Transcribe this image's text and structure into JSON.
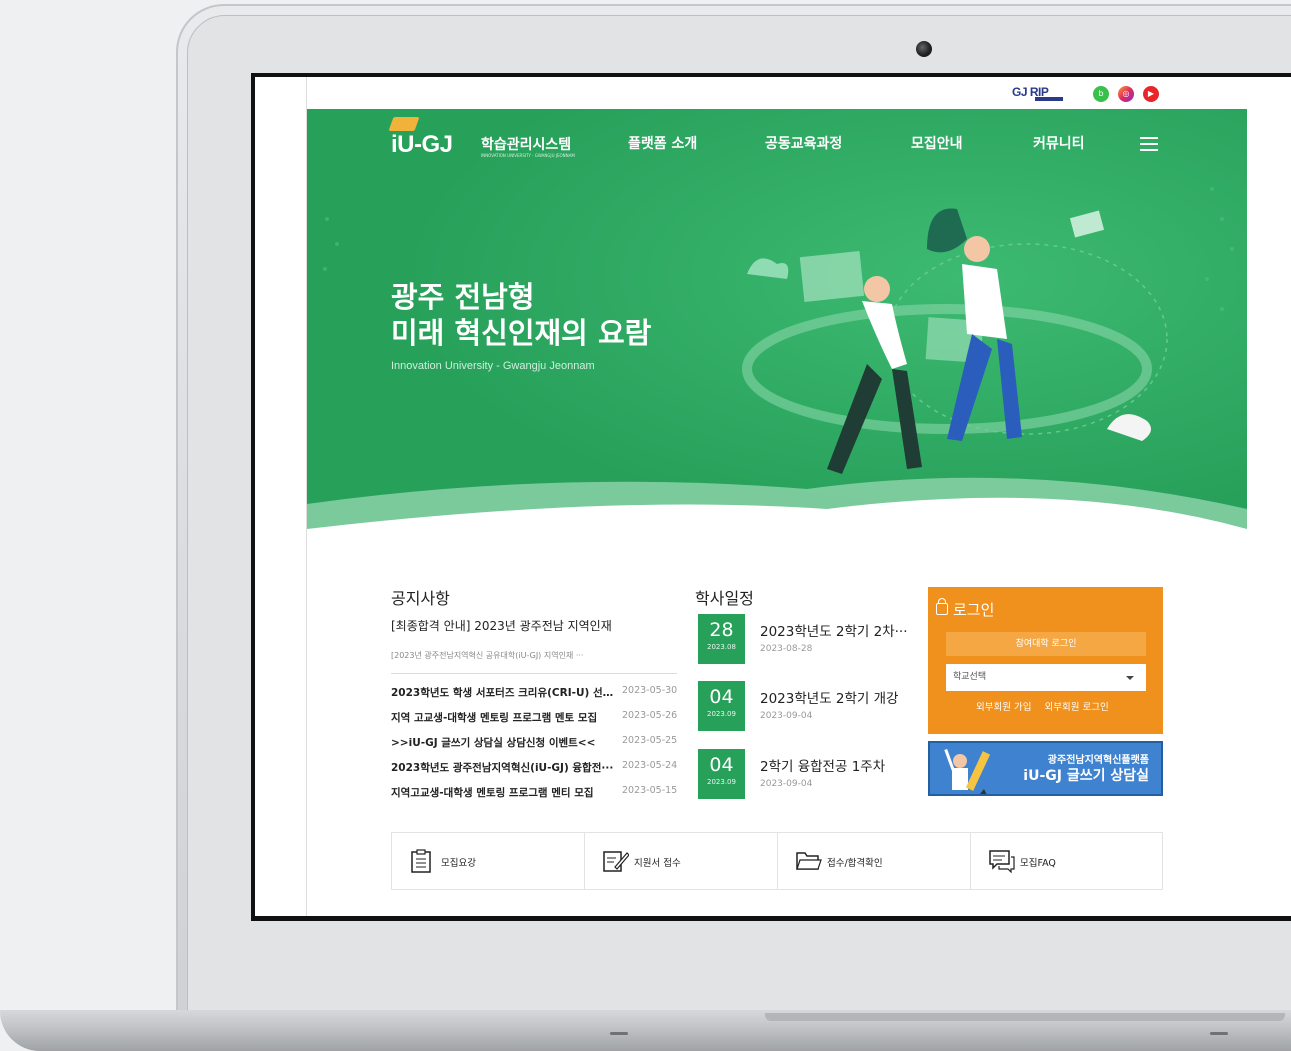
{
  "header": {
    "partner_logo": "GJ RIP",
    "social": [
      "blog-icon",
      "instagram-icon",
      "youtube-icon"
    ]
  },
  "brand": {
    "logo": "iU-GJ",
    "system_name": "학습관리시스템",
    "tagline": "INNOVATION UNIVERSITY · GWANGJU JEONNAM"
  },
  "nav": {
    "items": [
      "플랫폼 소개",
      "공동교육과정",
      "모집안내",
      "커뮤니티"
    ]
  },
  "hero": {
    "title_line1": "광주 전남형",
    "title_line2": "미래 혁신인재의 요람",
    "subtitle": "Innovation University - Gwangju Jeonnam"
  },
  "notices": {
    "title": "공지사항",
    "featured_title": "[최종합격 안내] 2023년 광주전남 지역인재",
    "featured_excerpt": "[2023년 광주전남지역혁신 공유대학(iU-GJ) 지역인재 ···",
    "items": [
      {
        "title": "2023학년도 학생 서포터즈 크리유(CRI-U) 선발···",
        "date": "2023-05-30"
      },
      {
        "title": "지역 고교생-대학생 멘토링 프로그램 멘토 모집",
        "date": "2023-05-26"
      },
      {
        "title": ">>iU-GJ 글쓰기 상담실 상담신청 이벤트<<",
        "date": "2023-05-25"
      },
      {
        "title": "2023학년도 광주전남지역혁신(iU-GJ) 융합전···",
        "date": "2023-05-24"
      },
      {
        "title": "지역고교생-대학생 멘토링 프로그램 멘티 모집",
        "date": "2023-05-15"
      }
    ]
  },
  "schedule": {
    "title": "학사일정",
    "items": [
      {
        "day": "28",
        "ym": "2023.08",
        "title": "2023학년도 2학기 2차···",
        "date": "2023-08-28"
      },
      {
        "day": "04",
        "ym": "2023.09",
        "title": "2023학년도 2학기 개강",
        "date": "2023-09-04"
      },
      {
        "day": "04",
        "ym": "2023.09",
        "title": "2학기 융합전공 1주차",
        "date": "2023-09-04"
      }
    ]
  },
  "login": {
    "title": "로그인",
    "member_login": "참여대학 로그인",
    "select_placeholder": "학교선택",
    "external_join": "외부회원 가입",
    "external_login": "외부회원 로그인"
  },
  "banner": {
    "line1": "광주전남지역혁신플랫폼",
    "line2": "iU-GJ 글쓰기 상담실"
  },
  "quick_links": {
    "items": [
      {
        "label": "모집요강",
        "icon": "clipboard-icon"
      },
      {
        "label": "지원서 접수",
        "icon": "application-pen-icon"
      },
      {
        "label": "접수/합격확인",
        "icon": "folder-icon"
      },
      {
        "label": "모집FAQ",
        "icon": "faq-chat-icon"
      }
    ]
  },
  "colors": {
    "brand_green": "#27a05a",
    "login_orange": "#f0901d",
    "banner_blue": "#3f82d0"
  }
}
